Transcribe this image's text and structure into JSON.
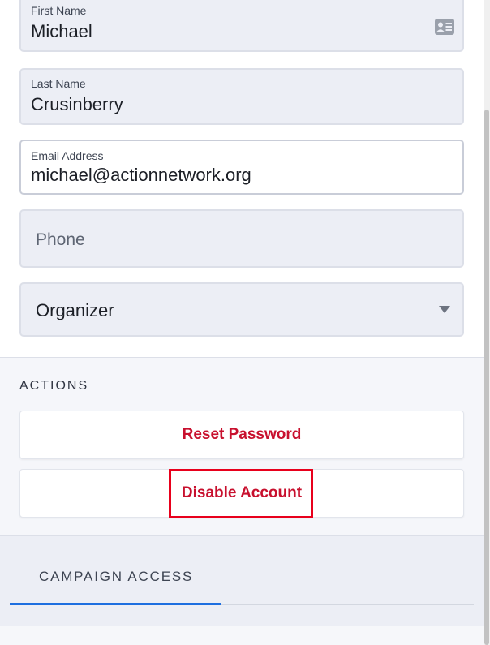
{
  "form": {
    "first_name": {
      "label": "First Name",
      "value": "Michael"
    },
    "last_name": {
      "label": "Last Name",
      "value": "Crusinberry"
    },
    "email": {
      "label": "Email Address",
      "value": "michael@actionnetwork.org"
    },
    "phone": {
      "placeholder": "Phone"
    },
    "role": {
      "value": "Organizer"
    }
  },
  "actions": {
    "title": "ACTIONS",
    "reset_password": "Reset Password",
    "disable_account": "Disable Account"
  },
  "campaign_access": {
    "tab_label": "CAMPAIGN ACCESS"
  },
  "colors": {
    "action_red": "#c8102e",
    "highlight": "#e8001c",
    "tab_active": "#1e6fe0"
  }
}
